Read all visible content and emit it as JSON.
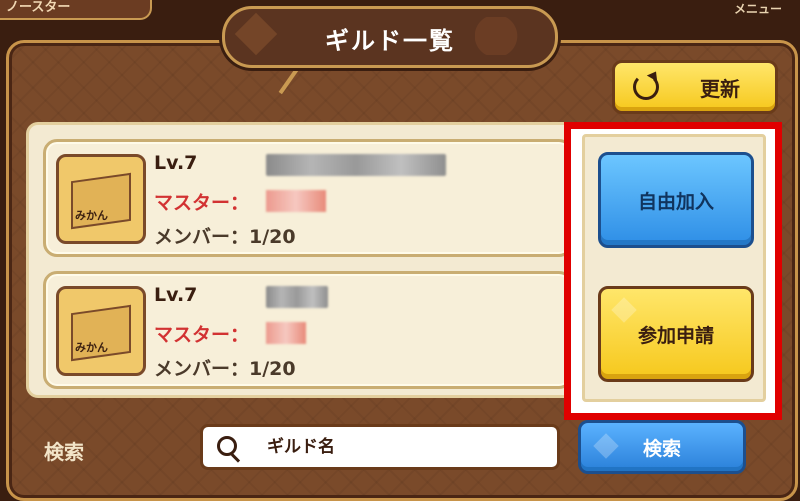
{
  "top_left_tab": "ノースター",
  "top_right_menu": "メニュー",
  "title": "ギルド一覧",
  "reload_label": "更新",
  "guilds": [
    {
      "level": "Lv.7",
      "icon_text": "みかん",
      "master_label": "マスター：",
      "members": "メンバー：1/20"
    },
    {
      "level": "Lv.7",
      "icon_text": "みかん",
      "master_label": "マスター：",
      "members": "メンバー：1/20"
    }
  ],
  "actions": {
    "free_join": "自由加入",
    "apply_join": "参加申請"
  },
  "search": {
    "label": "検索",
    "placeholder": "ギルド名",
    "button": "検索"
  },
  "colors": {
    "highlight": "#e00000",
    "blue_button": "#2e8ee6",
    "yellow_button": "#f6c81c",
    "master_red": "#d23232"
  }
}
